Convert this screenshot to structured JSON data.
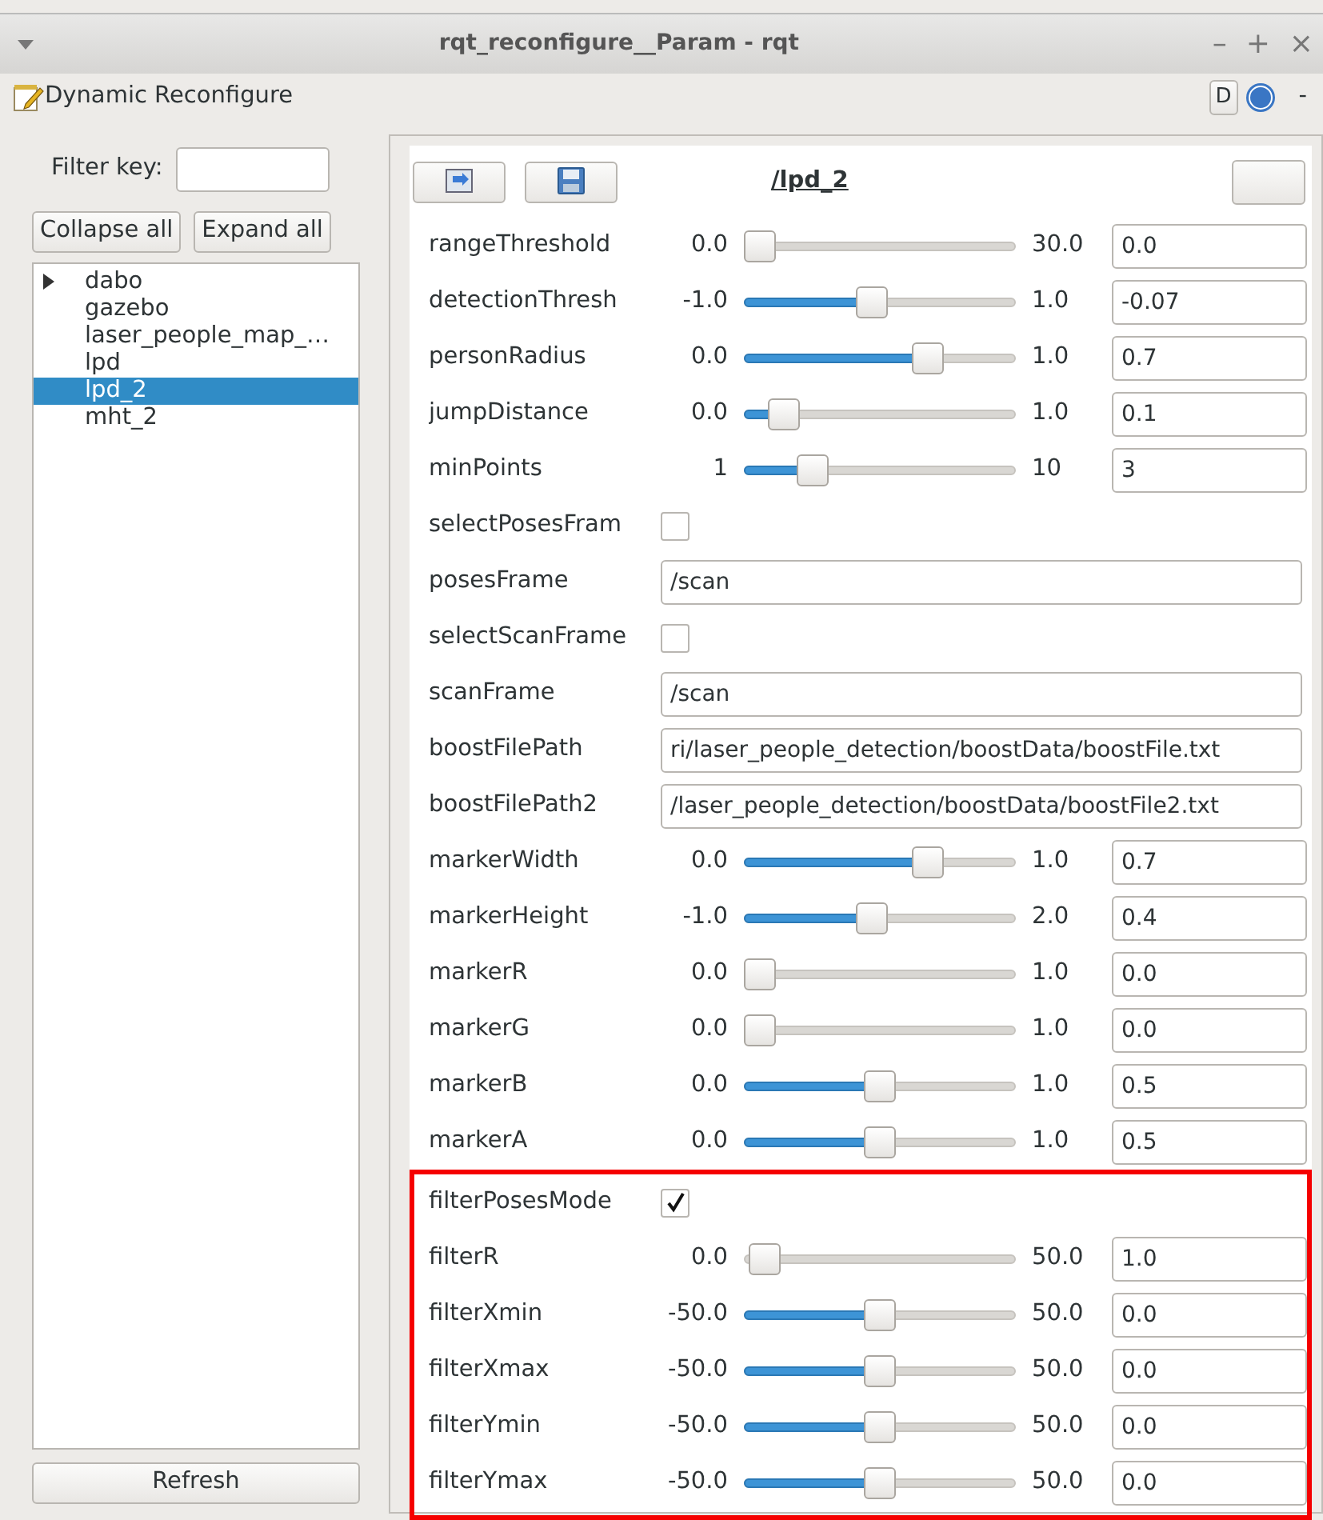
{
  "window": {
    "title": "rqt_reconfigure__Param - rqt",
    "controls": [
      "–",
      "+",
      "×"
    ]
  },
  "plugin": {
    "title": "Dynamic Reconfigure",
    "corner_buttons": [
      "D"
    ],
    "corner_text": "-"
  },
  "sidebar": {
    "filter_label": "Filter key:",
    "buttons": [
      "Collapse all",
      "Expand all"
    ],
    "tree": [
      {
        "label": "dabo",
        "has_children": true,
        "selected": false
      },
      {
        "label": "gazebo",
        "has_children": false,
        "selected": false
      },
      {
        "label": "laser_people_map_…",
        "has_children": false,
        "selected": false
      },
      {
        "label": "lpd",
        "has_children": false,
        "selected": false
      },
      {
        "label": "lpd_2",
        "has_children": false,
        "selected": true
      },
      {
        "label": "mht_2",
        "has_children": false,
        "selected": false
      }
    ],
    "refresh": "Refresh"
  },
  "node_title": "/lpd_2",
  "groups": [
    {
      "highlighted": false,
      "params": [
        {
          "kind": "slider",
          "name": "rangeThreshold",
          "min": "0.0",
          "max": "30.0",
          "level": 0.0,
          "value": "0.0"
        },
        {
          "kind": "slider",
          "name": "detectionThresh",
          "min": "-1.0",
          "max": "1.0",
          "level": 0.465,
          "value": "-0.07"
        },
        {
          "kind": "slider",
          "name": "personRadius",
          "min": "0.0",
          "max": "1.0",
          "level": 0.7,
          "value": "0.7"
        },
        {
          "kind": "slider",
          "name": "jumpDistance",
          "min": "0.0",
          "max": "1.0",
          "level": 0.1,
          "value": "0.1"
        },
        {
          "kind": "slider",
          "name": "minPoints",
          "min": "1",
          "max": "10",
          "level": 0.22,
          "value": "3"
        },
        {
          "kind": "checkbox",
          "name": "selectPosesFram",
          "checked": false
        },
        {
          "kind": "text",
          "name": "posesFrame",
          "value": "/scan"
        },
        {
          "kind": "checkbox",
          "name": "selectScanFrame",
          "checked": false
        },
        {
          "kind": "text",
          "name": "scanFrame",
          "value": "/scan"
        },
        {
          "kind": "text",
          "name": "boostFilePath",
          "value": "ri/laser_people_detection/boostData/boostFile.txt"
        },
        {
          "kind": "text",
          "name": "boostFilePath2",
          "value": "/laser_people_detection/boostData/boostFile2.txt"
        },
        {
          "kind": "slider",
          "name": "markerWidth",
          "min": "0.0",
          "max": "1.0",
          "level": 0.7,
          "value": "0.7"
        },
        {
          "kind": "slider",
          "name": "markerHeight",
          "min": "-1.0",
          "max": "2.0",
          "level": 0.467,
          "value": "0.4"
        },
        {
          "kind": "slider",
          "name": "markerR",
          "min": "0.0",
          "max": "1.0",
          "level": 0.0,
          "value": "0.0"
        },
        {
          "kind": "slider",
          "name": "markerG",
          "min": "0.0",
          "max": "1.0",
          "level": 0.0,
          "value": "0.0"
        },
        {
          "kind": "slider",
          "name": "markerB",
          "min": "0.0",
          "max": "1.0",
          "level": 0.5,
          "value": "0.5"
        },
        {
          "kind": "slider",
          "name": "markerA",
          "min": "0.0",
          "max": "1.0",
          "level": 0.5,
          "value": "0.5"
        }
      ]
    },
    {
      "highlighted": true,
      "params": [
        {
          "kind": "checkbox",
          "name": "filterPosesMode",
          "checked": true
        },
        {
          "kind": "slider",
          "name": "filterR",
          "min": "0.0",
          "max": "50.0",
          "level": 0.02,
          "value": "1.0"
        },
        {
          "kind": "slider",
          "name": "filterXmin",
          "min": "-50.0",
          "max": "50.0",
          "level": 0.5,
          "value": "0.0"
        },
        {
          "kind": "slider",
          "name": "filterXmax",
          "min": "-50.0",
          "max": "50.0",
          "level": 0.5,
          "value": "0.0"
        },
        {
          "kind": "slider",
          "name": "filterYmin",
          "min": "-50.0",
          "max": "50.0",
          "level": 0.5,
          "value": "0.0"
        },
        {
          "kind": "slider",
          "name": "filterYmax",
          "min": "-50.0",
          "max": "50.0",
          "level": 0.5,
          "value": "0.0"
        }
      ]
    }
  ]
}
